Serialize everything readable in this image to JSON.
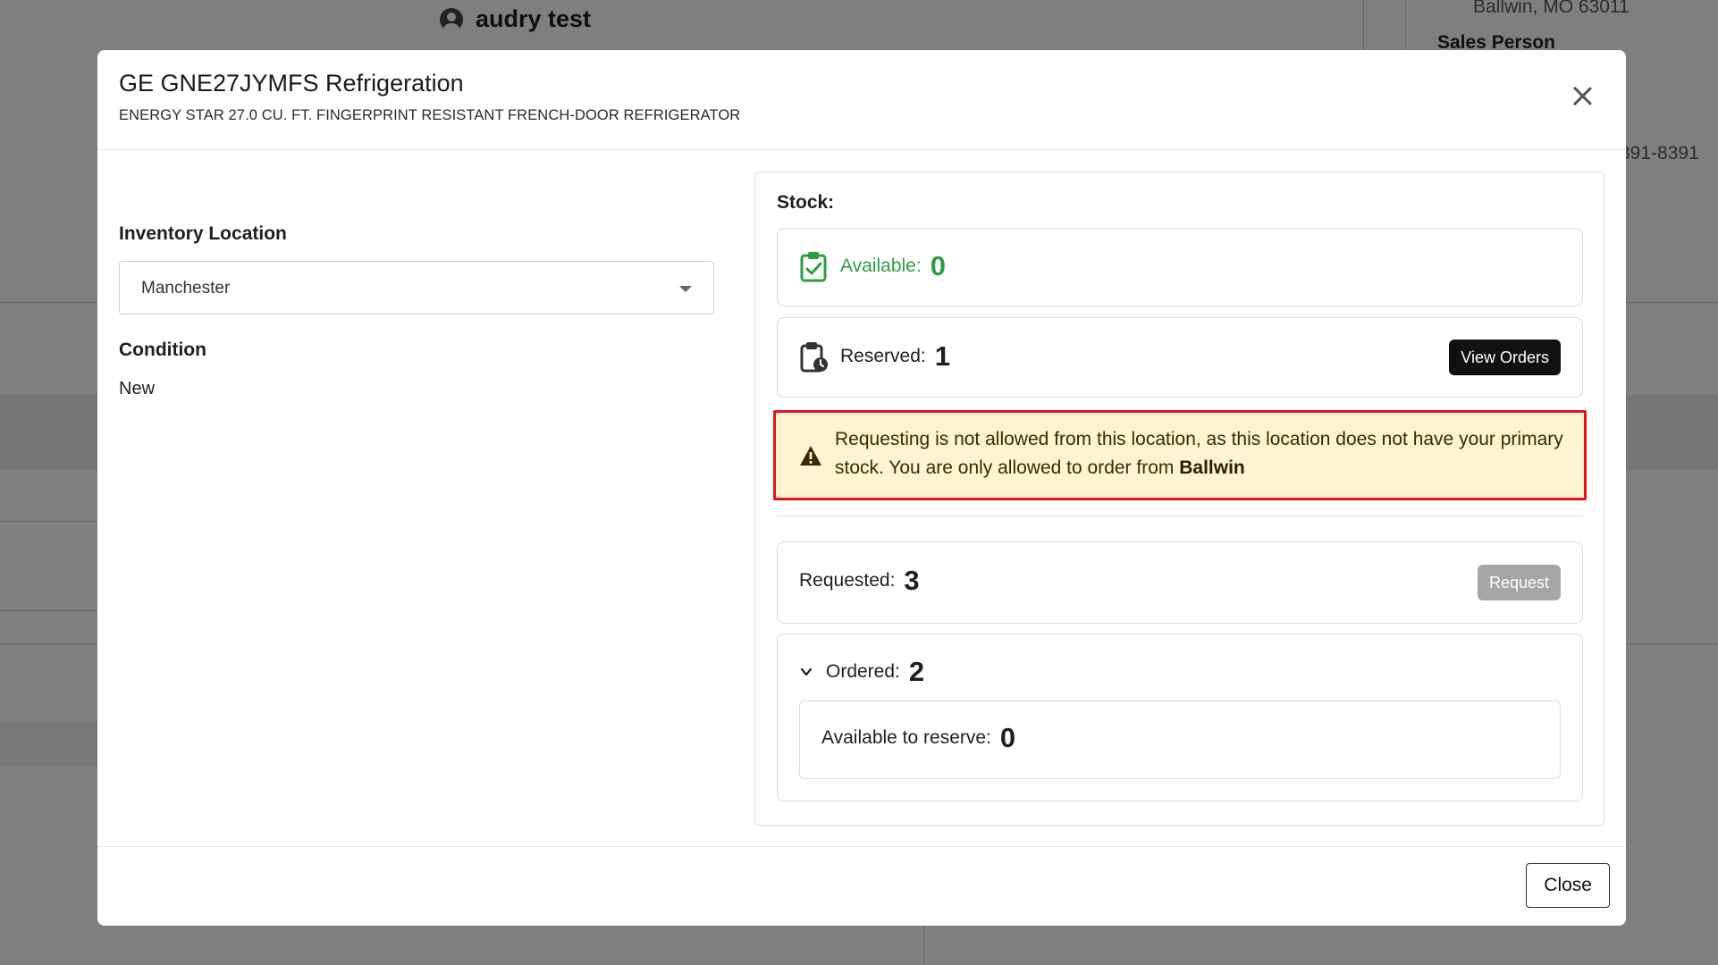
{
  "background": {
    "user_name": "audry test",
    "address_line": "Ballwin, MO 63011",
    "sales_person_label": "Sales Person",
    "phone_fragment": "391-8391"
  },
  "modal": {
    "title": "GE GNE27JYMFS Refrigeration",
    "subtitle": "ENERGY STAR 27.0 CU. FT. FINGERPRINT RESISTANT FRENCH-DOOR REFRIGERATOR",
    "close_icon": "close-icon",
    "inventory_location": {
      "label": "Inventory Location",
      "selected": "Manchester"
    },
    "condition": {
      "label": "Condition",
      "value": "New"
    },
    "stock": {
      "label": "Stock:",
      "available": {
        "label": "Available:",
        "value": "0",
        "icon": "clipboard-check-icon",
        "color": "#2e9e3f"
      },
      "reserved": {
        "label": "Reserved:",
        "value": "1",
        "icon": "clipboard-clock-icon",
        "button": "View Orders"
      },
      "alert": {
        "icon": "warning-icon",
        "text": "Requesting is not allowed from this location, as this location does not have your primary stock. You are only allowed to order from",
        "location": "Ballwin",
        "border_color": "#e5121c",
        "background": "#fef4d2"
      },
      "requested": {
        "label": "Requested:",
        "value": "3",
        "button": "Request"
      },
      "ordered": {
        "label": "Ordered:",
        "value": "2",
        "icon": "chevron-down-icon",
        "available_to_reserve": {
          "label": "Available to reserve:",
          "value": "0"
        }
      }
    },
    "footer": {
      "close_label": "Close"
    }
  }
}
